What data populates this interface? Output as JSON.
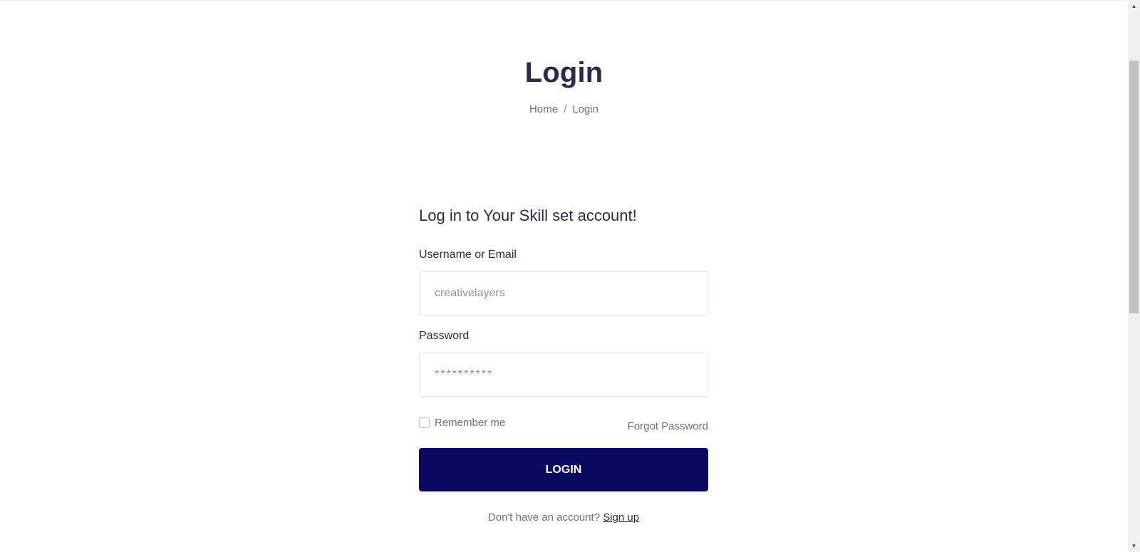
{
  "header": {
    "title": "Login",
    "breadcrumb": {
      "home": "Home",
      "separator": "/",
      "current": "Login"
    }
  },
  "form": {
    "heading": "Log in to Your Skill set account!",
    "username_label": "Username or Email",
    "username_placeholder": "creativelayers",
    "password_label": "Password",
    "password_placeholder": "**********",
    "remember_label": "Remember me",
    "remember_checked": false,
    "forgot_label": "Forgot Password",
    "submit_label": "LOGIN",
    "signup_prompt": "Don't have an account?",
    "signup_link": "Sign up"
  },
  "colors": {
    "primary_button": "#0b0860",
    "heading_text": "#2b2a4c",
    "muted_text": "#6b6f80"
  },
  "icons": {
    "scroll_up": "triangle-up-icon",
    "scroll_down": "triangle-down-icon"
  }
}
